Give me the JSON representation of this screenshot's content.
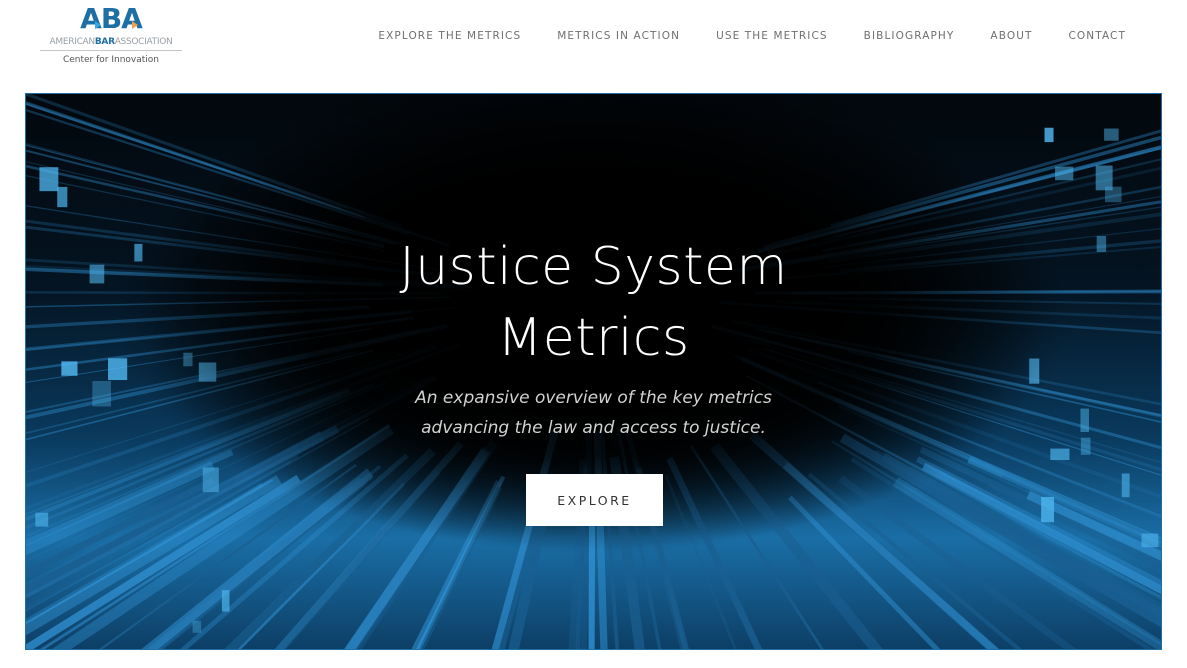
{
  "logo": {
    "mark": "ABA",
    "org_prefix": "AMERICAN",
    "org_bold": "BAR",
    "org_suffix": "ASSOCIATION",
    "subtitle": "Center for Innovation",
    "colors": {
      "primary": "#1d6fa5",
      "accent_blue": "#3aa8e0",
      "accent_orange": "#f0a050"
    }
  },
  "nav": {
    "items": [
      {
        "label": "EXPLORE THE METRICS"
      },
      {
        "label": "METRICS IN ACTION"
      },
      {
        "label": "USE THE METRICS"
      },
      {
        "label": "BIBLIOGRAPHY"
      },
      {
        "label": "ABOUT"
      },
      {
        "label": "CONTACT"
      }
    ]
  },
  "hero": {
    "title_line1": "Justice System",
    "title_line2": "Metrics",
    "subtitle_line1": "An expansive overview of the key metrics",
    "subtitle_line2": "advancing the law and access to justice.",
    "button_label": "EXPLORE",
    "background_icon": "data-center-light-streaks-image",
    "colors": {
      "border": "#1c6ea4",
      "glow": "#1a6ea6",
      "dark": "#02070c"
    }
  }
}
